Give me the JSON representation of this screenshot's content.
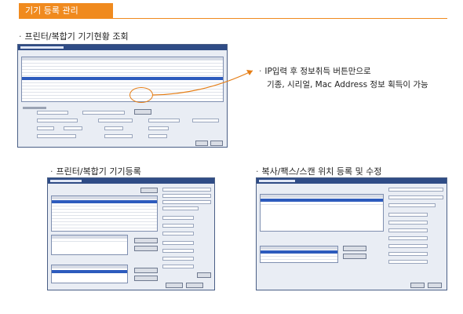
{
  "header": {
    "title": "기기 등록 관리"
  },
  "section_top": {
    "heading": "프린터/복합기 기기현황 조회",
    "bullet": "·"
  },
  "section_register": {
    "heading": "프린터/복합기 기기등록",
    "bullet": "·"
  },
  "section_scan": {
    "heading": "복사/팩스/스캔 위치 등록 및 수정",
    "bullet": "·"
  },
  "note": {
    "bullet": "·",
    "line1": "IP입력 후 정보취득 버튼만으로",
    "line2": "기종, 시리얼, Mac Address 정보 획득이 가능"
  },
  "colors": {
    "accent": "#f08a1e",
    "window_caption": "#2f4c86",
    "selected_row": "#2d5bbd",
    "callout": "#e57d14"
  }
}
